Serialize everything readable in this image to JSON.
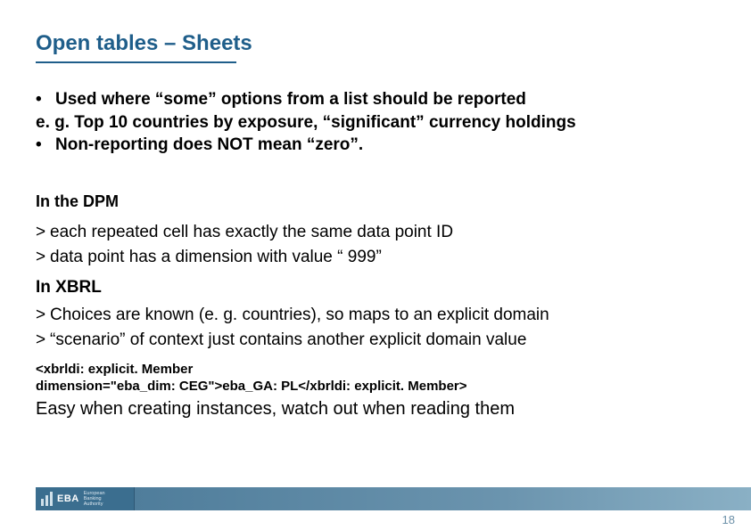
{
  "title": "Open tables – Sheets",
  "intro": {
    "bullet1": "Used where “some” options from a list should be reported",
    "example": "e. g. Top 10 countries by exposure, “significant” currency holdings",
    "bullet2": "Non-reporting does NOT mean “zero”."
  },
  "dpm": {
    "heading": "In the DPM",
    "item1": "each repeated cell has exactly the same data point ID",
    "item2": "data point has a dimension with value “ 999”"
  },
  "xbrl": {
    "heading": "In XBRL",
    "item1": "Choices are known (e. g. countries), so maps to an explicit domain",
    "item2": "“scenario” of context just contains another explicit domain value"
  },
  "code": {
    "line1": "<xbrldi: explicit. Member",
    "line2": "dimension=\"eba_dim: CEG\">eba_GA: PL</xbrldi: explicit. Member>"
  },
  "closing": "Easy when creating instances, watch out when reading them",
  "footer": {
    "logo_text": "EBA",
    "logo_sub1": "European",
    "logo_sub2": "Banking",
    "logo_sub3": "Authority",
    "page": "18"
  }
}
